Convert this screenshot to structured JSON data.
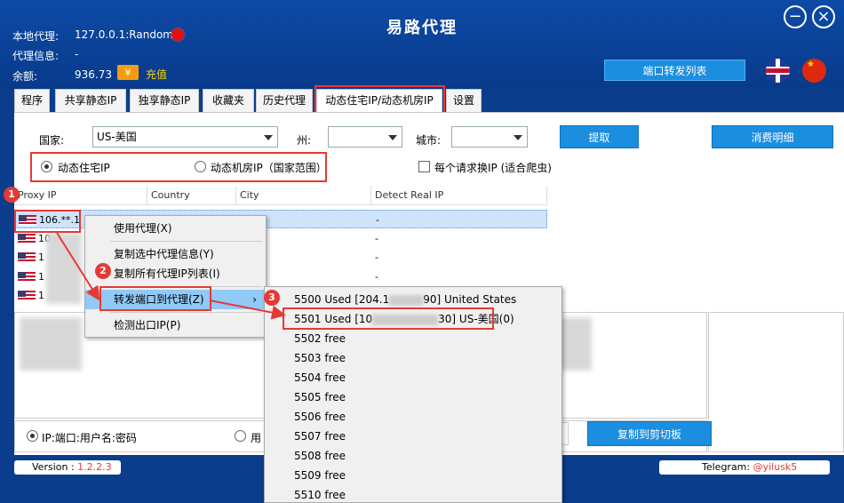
{
  "app": {
    "title": "易路代理"
  },
  "info": {
    "local_proxy_label": "本地代理:",
    "local_proxy_value": "127.0.0.1:Random",
    "proxy_info_label": "代理信息:",
    "proxy_info_value": "-",
    "balance_label": "余额:",
    "balance_value": "936.73",
    "yen_icon": "¥",
    "recharge": "充值"
  },
  "header": {
    "port_forward_list": "端口转发列表"
  },
  "tabs": [
    "程序",
    "共享静态IP",
    "独享静态IP",
    "收藏夹",
    "历史代理",
    "动态住宅IP/动态机房IP",
    "设置"
  ],
  "filters": {
    "country_label": "国家:",
    "country_value": "US-美国",
    "state_label": "州:",
    "city_label": "城市:",
    "fetch_button": "提取",
    "consumption_button": "消费明细",
    "radio_residential": "动态住宅IP",
    "radio_datacenter": "动态机房IP（国家范围）",
    "per_request_label": "每个请求换IP (适合爬虫)"
  },
  "table": {
    "headers": [
      "Proxy IP",
      "Country",
      "City",
      "Detect Real IP"
    ],
    "rows": [
      {
        "ip": "106.**.1",
        "detect": "-"
      },
      {
        "ip": "10",
        "detect": "-"
      },
      {
        "ip": "1",
        "detect": "-"
      },
      {
        "ip": "1",
        "detect": "-"
      },
      {
        "ip": "1",
        "detect": "-"
      }
    ]
  },
  "lower": {
    "format_radio": "IP:端口:用户名:密码",
    "format_radio2": "用",
    "copy_button": "复制到剪切板"
  },
  "footer": {
    "version_label": "Version : ",
    "version": "1.2.2.3",
    "telegram_label": "Telegram: ",
    "telegram": "@yilusk5"
  },
  "context_menu": {
    "items": [
      "使用代理(X)",
      "复制选中代理信息(Y)",
      "复制所有代理IP列表(I)",
      "转发端口到代理(Z)",
      "检测出口IP(P)"
    ],
    "submenu_arrow": "›"
  },
  "submenu": {
    "items": [
      "5500 Used [204.1",
      "5501 Used [10",
      "5502 free",
      "5503 free",
      "5504 free",
      "5505 free",
      "5506 free",
      "5507 free",
      "5508 free",
      "5509 free",
      "5510 free"
    ],
    "item0_tail": "90] United States",
    "item1_tail": "30] US-美国(0)"
  },
  "badges": [
    "1",
    "2",
    "3"
  ],
  "colors": {
    "accent": "#1b8ee0",
    "header_bg": "#0a3d8c",
    "highlight": "#e53935"
  }
}
